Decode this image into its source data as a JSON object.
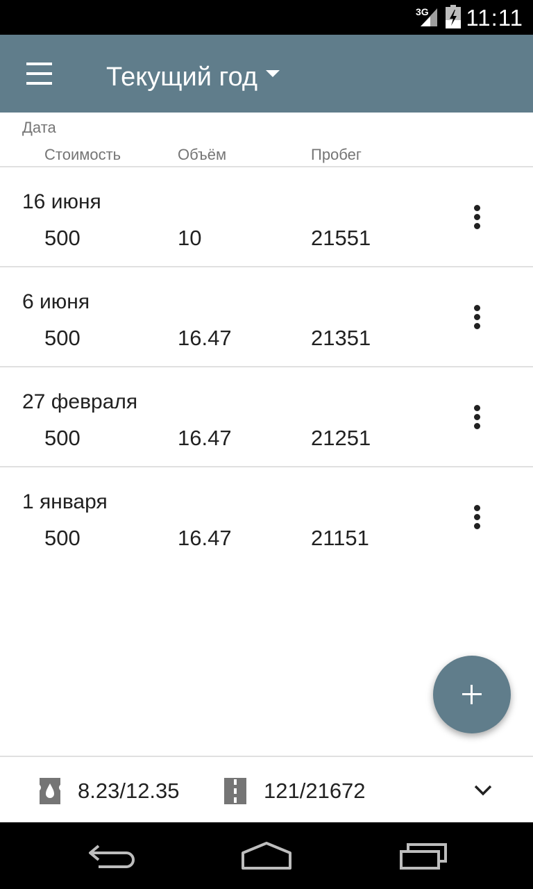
{
  "status_bar": {
    "network": "3G",
    "time": "11:11"
  },
  "app_bar": {
    "title": "Текущий год",
    "menu_icon": "menu-icon",
    "dropdown_icon": "dropdown-arrow-icon"
  },
  "columns": {
    "date": "Дата",
    "cost": "Стоимость",
    "volume": "Объём",
    "mileage": "Пробег"
  },
  "entries": [
    {
      "date": "16 июня",
      "cost": "500",
      "volume": "10",
      "mileage": "21551"
    },
    {
      "date": "6 июня",
      "cost": "500",
      "volume": "16.47",
      "mileage": "21351"
    },
    {
      "date": "27 февраля",
      "cost": "500",
      "volume": "16.47",
      "mileage": "21251"
    },
    {
      "date": "1 января",
      "cost": "500",
      "volume": "16.47",
      "mileage": "21151"
    }
  ],
  "summary": {
    "consumption": "8.23/12.35",
    "distance": "121/21672",
    "consumption_icon": "fuel-drop-icon",
    "distance_icon": "road-icon",
    "expand_icon": "chevron-down-icon"
  },
  "fab": {
    "icon": "plus-icon"
  },
  "nav": {
    "back_icon": "back-icon",
    "home_icon": "home-icon",
    "recents_icon": "recents-icon"
  },
  "colors": {
    "primary": "#607d8b",
    "text": "#212121",
    "secondary_text": "#757575",
    "divider": "#e0e0e0"
  }
}
